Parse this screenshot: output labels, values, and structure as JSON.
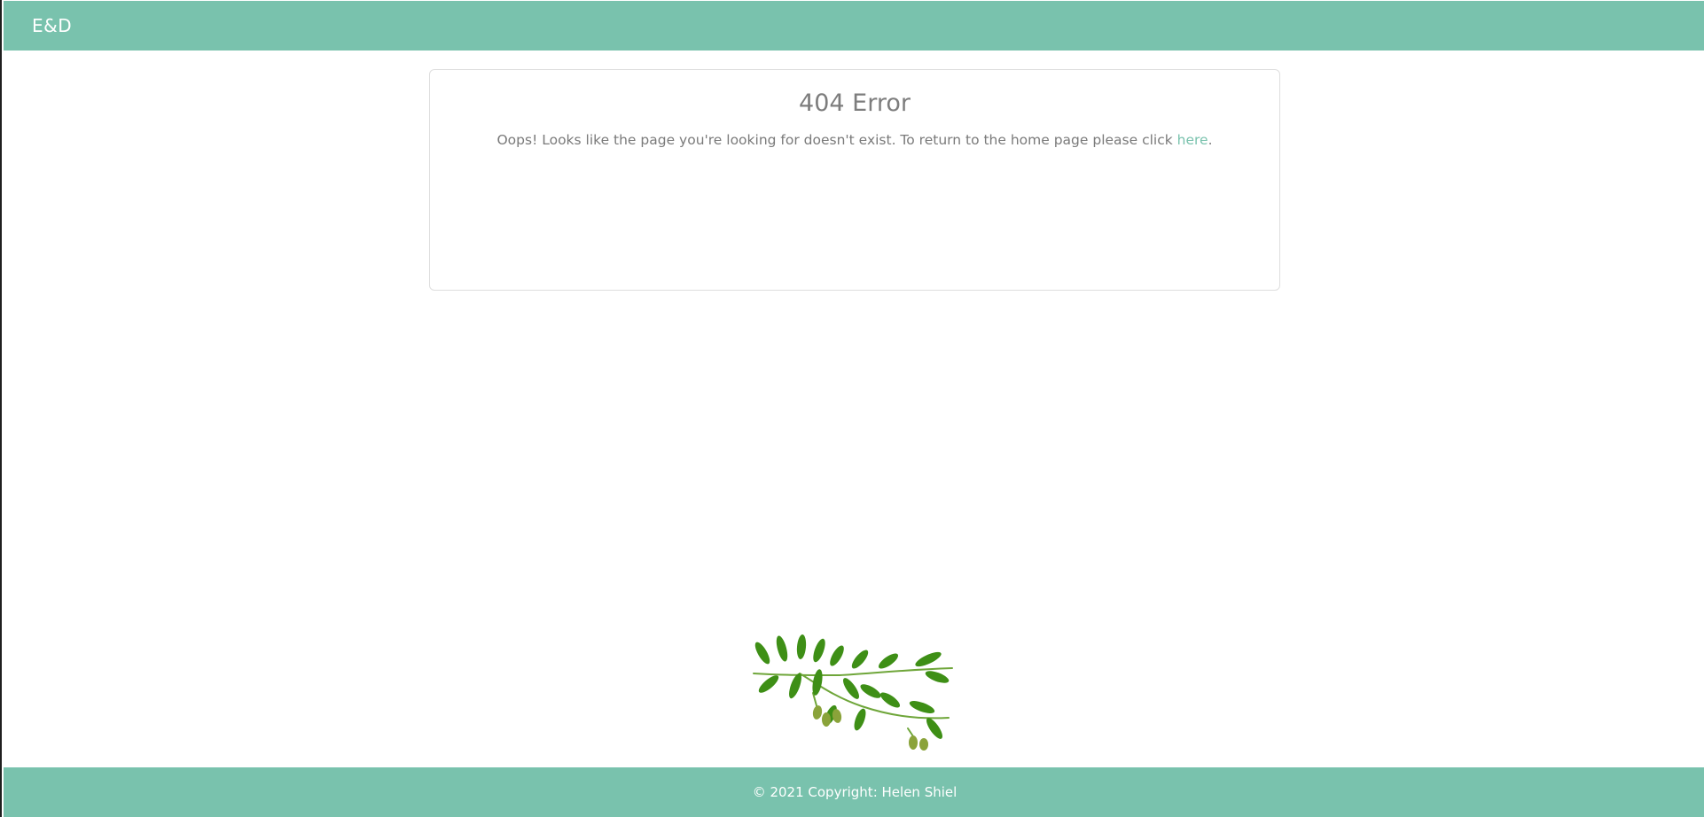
{
  "navbar": {
    "brand": "E&D"
  },
  "error_card": {
    "title": "404 Error",
    "message_before_link": "Oops! Looks like the page you're looking for doesn't exist. To return to the home page please click ",
    "link_text": "here",
    "message_after_link": "."
  },
  "decoration": {
    "image": "olive-branch-icon"
  },
  "footer": {
    "copyright": "© 2021 Copyright: Helen Shiel"
  },
  "colors": {
    "accent": "#79c2ad",
    "text_muted": "#7d7d7d",
    "leaf_dark": "#2f7d12",
    "leaf_light": "#6fb52a",
    "olive": "#8aa33a"
  }
}
